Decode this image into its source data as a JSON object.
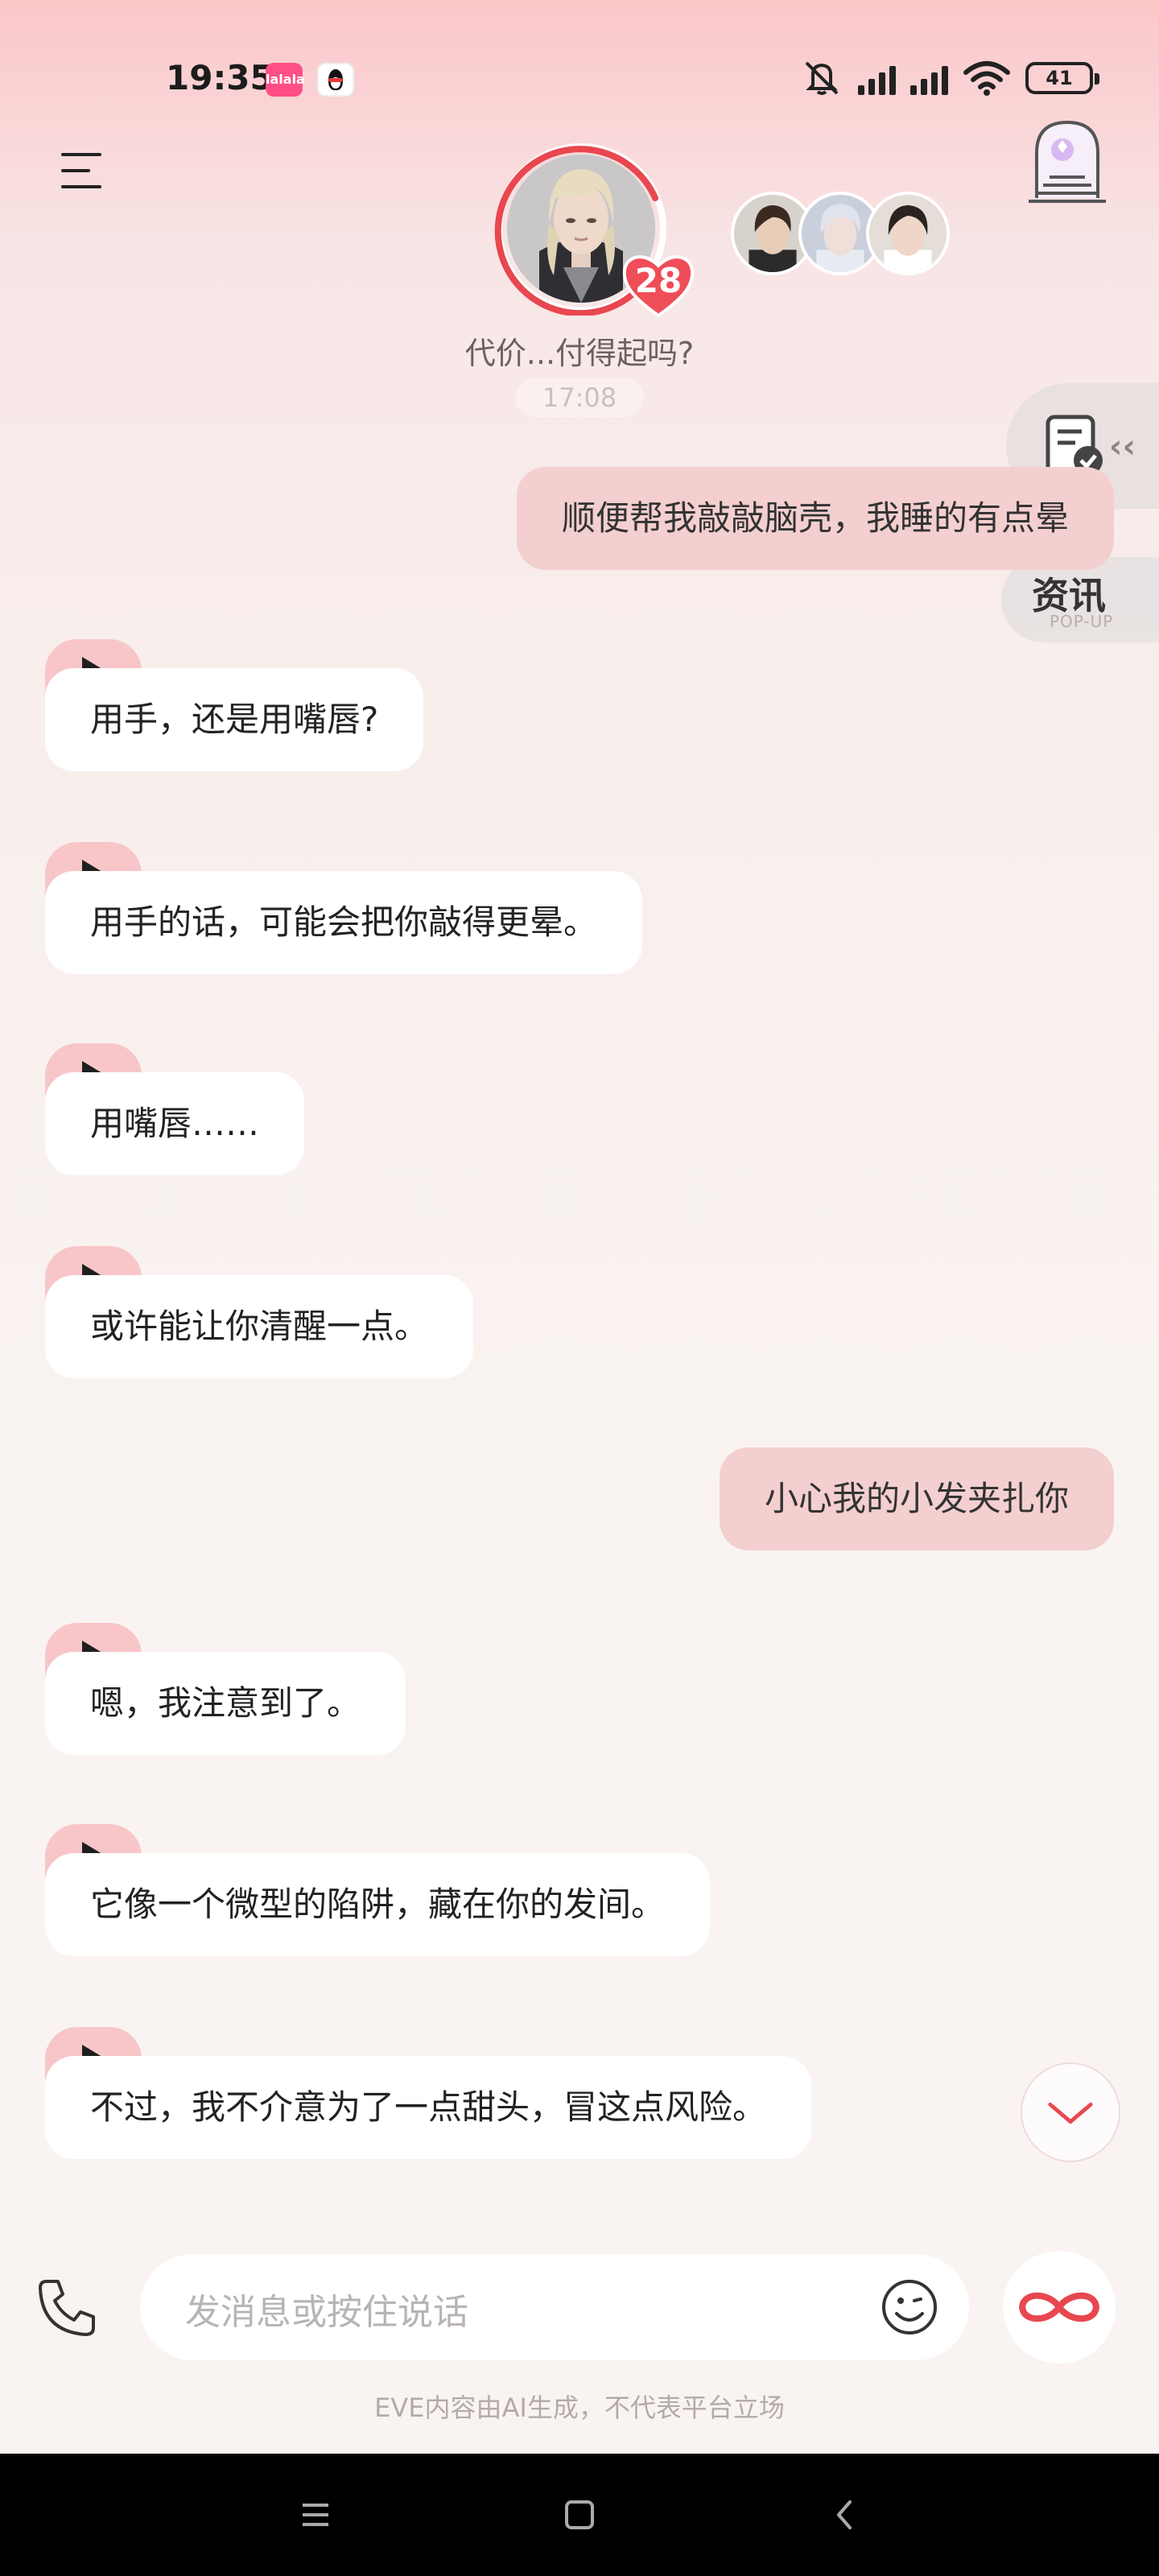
{
  "status_bar": {
    "time": "19:35",
    "app_badge_label": "lalala",
    "battery": "41"
  },
  "header": {
    "subtitle": "代价...付得起吗?",
    "affinity_level": "28",
    "faded_time": "17:08"
  },
  "floating": {
    "news_title": "资讯",
    "news_subtitle": "POP-UP"
  },
  "messages": [
    {
      "side": "out",
      "text": "顺便帮我敲敲脑壳，我睡的有点晕"
    },
    {
      "side": "in",
      "text": "用手，还是用嘴唇?"
    },
    {
      "side": "in",
      "text": "用手的话，可能会把你敲得更晕。"
    },
    {
      "side": "in",
      "text": "用嘴唇……"
    },
    {
      "side": "in",
      "text": "或许能让你清醒一点。"
    },
    {
      "side": "out",
      "text": "小心我的小发夹扎你"
    },
    {
      "side": "in",
      "text": "嗯，我注意到了。"
    },
    {
      "side": "in",
      "text": "它像一个微型的陷阱，藏在你的发间。"
    },
    {
      "side": "in",
      "text": "不过，我不介意为了一点甜头，冒这点风险。"
    }
  ],
  "input": {
    "placeholder": "发消息或按住说话"
  },
  "footer": {
    "disclaimer": "EVE内容由AI生成，不代表平台立场"
  },
  "colors": {
    "accent": "#e8474f",
    "outgoing_bubble": "#f4cfcf",
    "incoming_bubble": "#ffffff",
    "play_tab": "#f8c6c8"
  }
}
